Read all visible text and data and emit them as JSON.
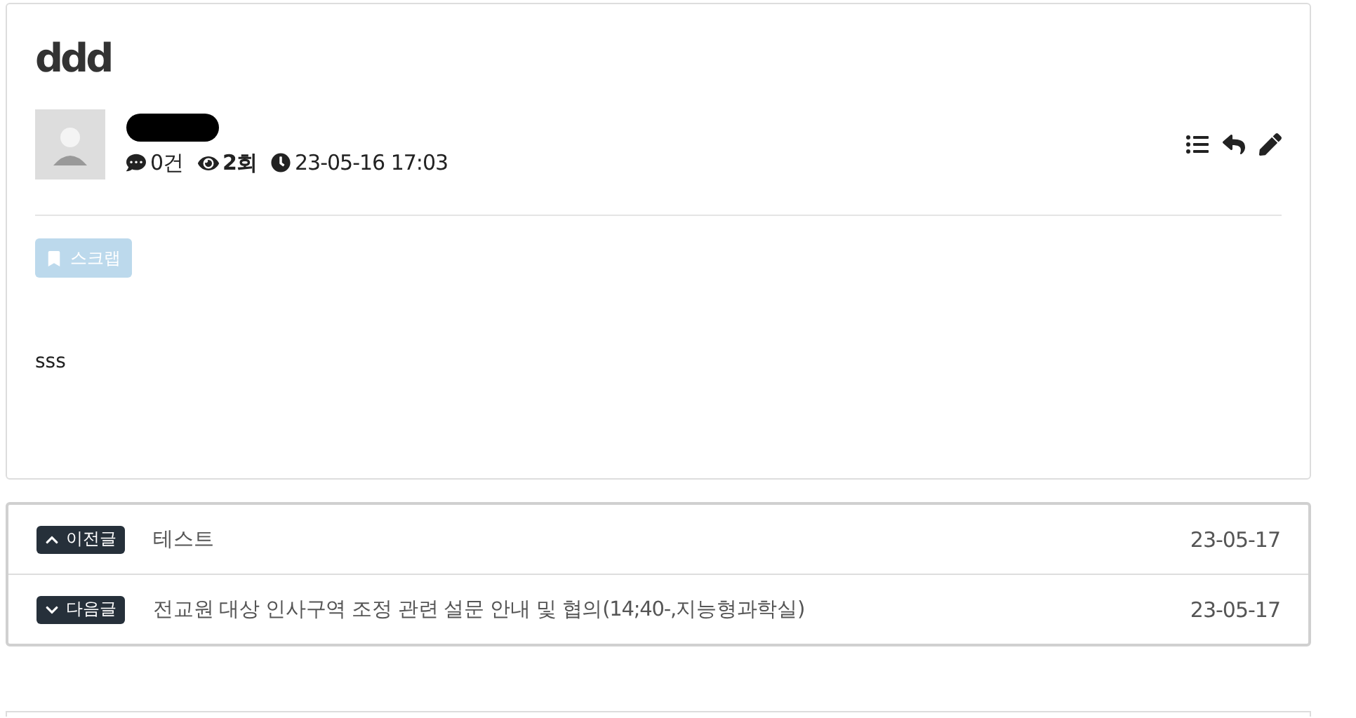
{
  "post": {
    "title": "ddd",
    "author": {
      "redacted": true
    },
    "stats": [
      {
        "kind": "comments",
        "text": "0건"
      },
      {
        "kind": "views",
        "text": "2회"
      },
      {
        "kind": "date",
        "text": "23-05-16 17:03"
      }
    ],
    "scrap_button": {
      "label": "스크랩",
      "disabled": true
    },
    "body": "sss"
  },
  "nav": [
    {
      "kind": "prev",
      "label": "이전글",
      "title": "테스트",
      "date": "23-05-17"
    },
    {
      "kind": "next",
      "label": "다음글",
      "title": "전교원 대상 인사구역 조정 관련 설문 안내 및 협의(14;40-,지능형과학실)",
      "date": "23-05-17"
    }
  ]
}
